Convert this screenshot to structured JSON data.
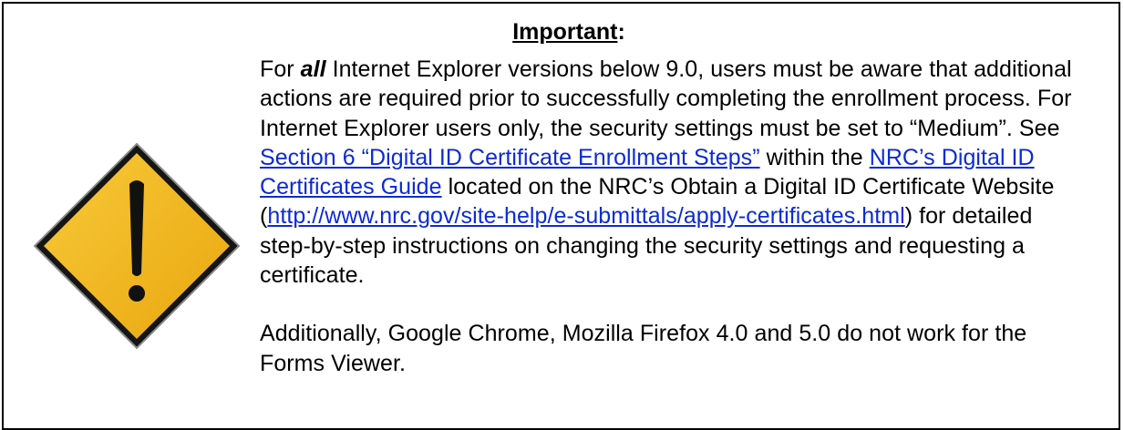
{
  "notice": {
    "title": "Important",
    "title_colon": ":",
    "paragraph1": {
      "seg1": "For ",
      "emph": "all",
      "seg2": " Internet Explorer versions below 9.0, users must be aware that additional actions are required prior to successfully completing the enrollment process.   For Internet Explorer users only, the security settings must be set to “Medium”.  See ",
      "link_section6": "Section 6 “Digital ID Certificate Enrollment Steps”",
      "seg3": " within the ",
      "link_guide": "NRC’s Digital ID Certificates Guide",
      "seg4": " located on the NRC’s Obtain a Digital ID Certificate Website (",
      "link_url": "http://www.nrc.gov/site-help/e-submittals/apply-certificates.html",
      "seg5": ") for detailed step-by-step instructions on changing the security settings and requesting a certificate."
    },
    "paragraph2": "Additionally, Google Chrome, Mozilla Firefox 4.0 and 5.0 do not work for the Forms Viewer."
  },
  "icon": {
    "name": "warning-icon",
    "fill_color": "#F2B516",
    "border_color": "#111111"
  },
  "colors": {
    "link": "#0B2BD6",
    "border": "#000000"
  }
}
